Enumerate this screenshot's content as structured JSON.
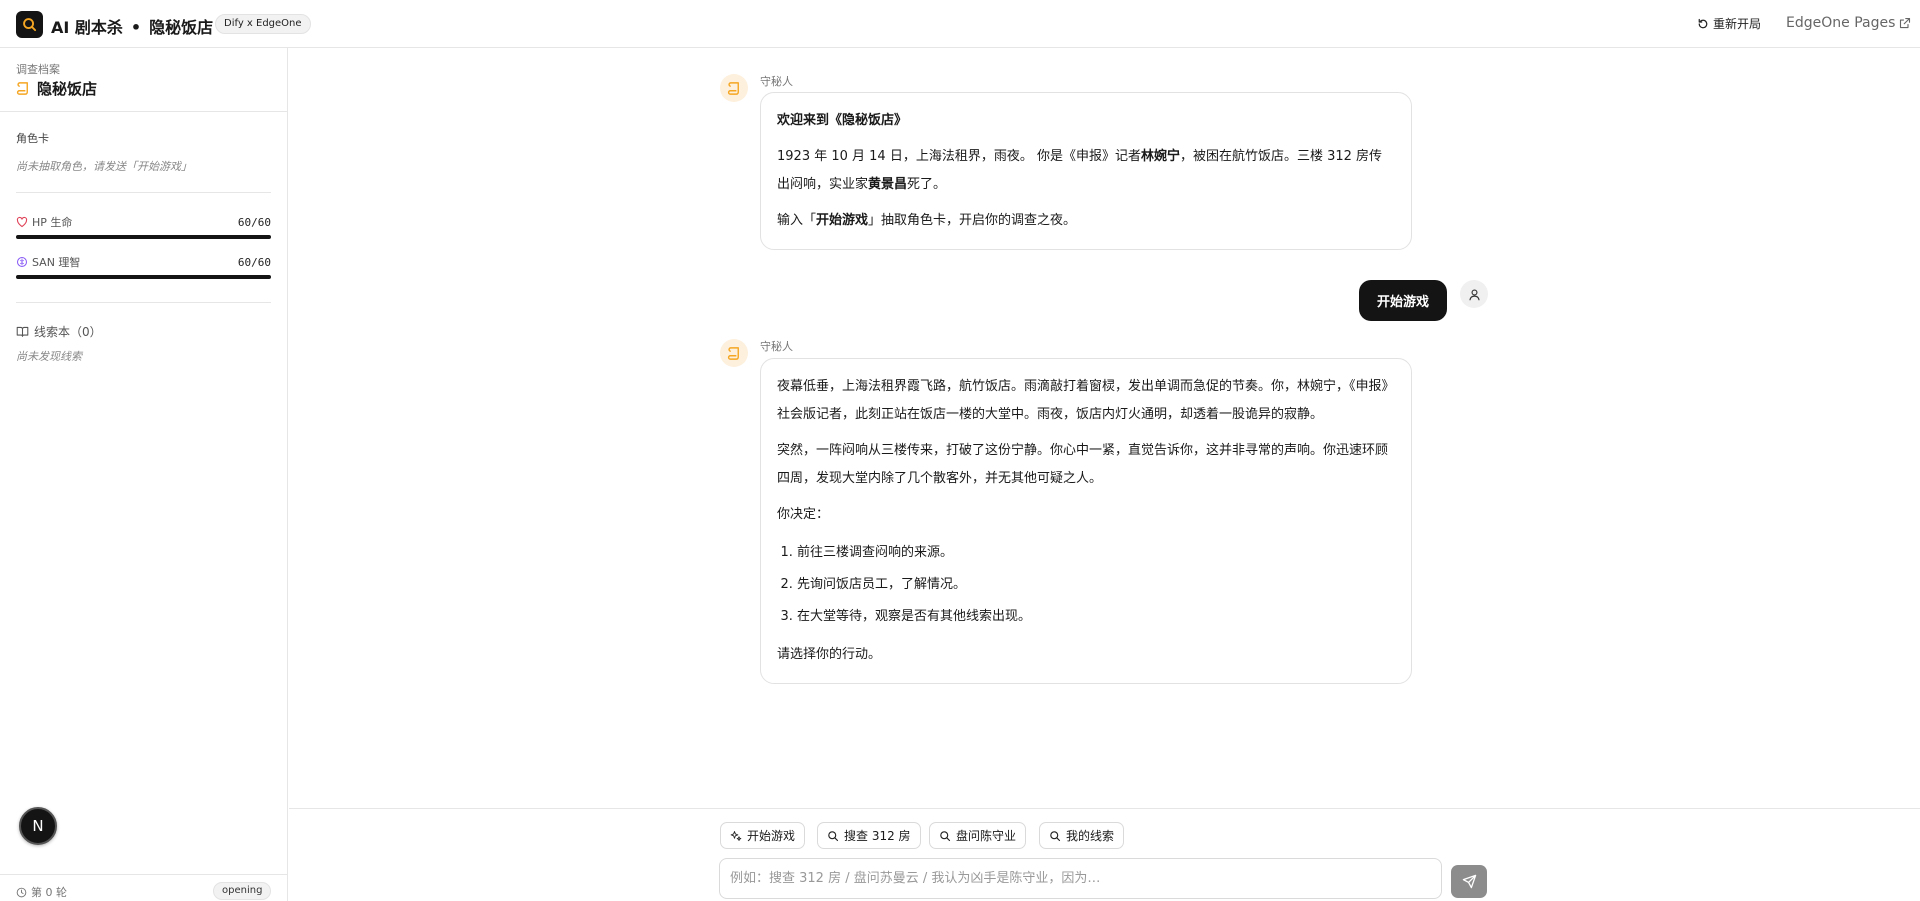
{
  "header": {
    "app_title": "AI 剧本杀",
    "separator": "•",
    "story_title": "隐秘饭店",
    "badge": "Dify x EdgeOne",
    "restart_label": "重新开局",
    "edgeone_label": "EdgeOne Pages"
  },
  "sidebar": {
    "case_label": "调查档案",
    "case_title": "隐秘饭店",
    "role_label": "角色卡",
    "role_empty": "尚未抽取角色，请发送「开始游戏」",
    "hp": {
      "label": "HP 生命",
      "value": "60/60",
      "fraction": 1.0
    },
    "san": {
      "label": "SAN 理智",
      "value": "60/60",
      "fraction": 1.0
    },
    "clues_label": "线索本（0）",
    "clues_empty": "尚未发现线索",
    "round_label": "第 0 轮",
    "phase_badge": "opening",
    "avatar_letter": "N"
  },
  "chat": {
    "messages": [
      {
        "sender": "守秘人",
        "title": "欢迎来到《隐秘饭店》",
        "p1_a": "1923 年 10 月 14 日，上海法租界，雨夜。 你是《申报》记者",
        "p1_name1": "林婉宁",
        "p1_b": "，被困在航竹饭店。三楼 312 房传出闷响，实业家",
        "p1_name2": "黄景昌",
        "p1_c": "死了。",
        "p2_a": "输入「",
        "p2_cmd": "开始游戏",
        "p2_b": "」抽取角色卡，开启你的调查之夜。"
      },
      {
        "sender": "守秘人",
        "p1": "夜幕低垂，上海法租界霞飞路，航竹饭店。雨滴敲打着窗棂，发出单调而急促的节奏。你，林婉宁，《申报》社会版记者，此刻正站在饭店一楼的大堂中。雨夜，饭店内灯火通明，却透着一股诡异的寂静。",
        "p2": "突然，一阵闷响从三楼传来，打破了这份宁静。你心中一紧，直觉告诉你，这并非寻常的声响。你迅速环顾四周，发现大堂内除了几个散客外，并无其他可疑之人。",
        "p3": "你决定：",
        "options": [
          "前往三楼调查闷响的来源。",
          "先询问饭店员工，了解情况。",
          "在大堂等待，观察是否有其他线索出现。"
        ],
        "p4": "请选择你的行动。"
      }
    ],
    "user_message": "开始游戏"
  },
  "bottom": {
    "chips": [
      "开始游戏",
      "搜查 312 房",
      "盘问陈守业",
      "我的线索"
    ],
    "input_placeholder": "例如：搜查 312 房 / 盘问苏曼云 / 我认为凶手是陈守业，因为…"
  },
  "colors": {
    "accent": "#f5a623",
    "dark": "#141414",
    "hp_icon": "#e0445a",
    "san_icon": "#8a5cf6"
  }
}
